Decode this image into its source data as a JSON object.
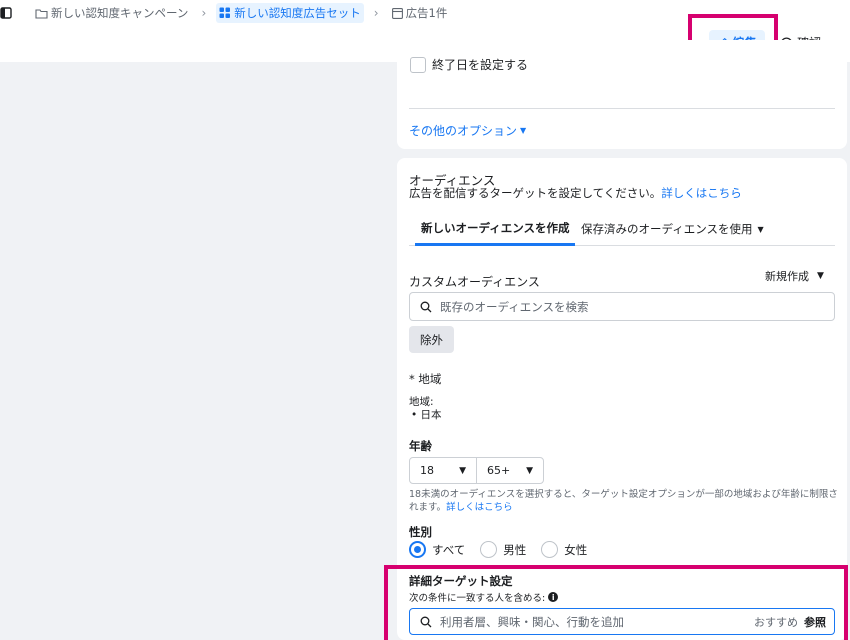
{
  "breadcrumb": {
    "campaign": "新しい認知度キャンペーン",
    "adset": "新しい認知度広告セット",
    "ads": "広告1件"
  },
  "header": {
    "edit_label": "編集",
    "review_label": "確認"
  },
  "schedule": {
    "end_date_label": "終了日を設定する",
    "more_options": "その他のオプション"
  },
  "audience": {
    "title": "オーディエンス",
    "subtitle": "広告を配信するターゲットを設定してください。",
    "learn_more": "詳しくはこちら",
    "tabs": [
      {
        "label": "新しいオーディエンスを作成"
      },
      {
        "label": "保存済みのオーディエンスを使用"
      }
    ],
    "custom_audience_label": "カスタムオーディエンス",
    "new_create": "新規作成",
    "search_placeholder": "既存のオーディエンスを検索",
    "exclude_label": "除外",
    "location_label": "* 地域",
    "location_sub": "地域:",
    "location_value": "• 日本",
    "age_label": "年齢",
    "age_min": "18",
    "age_max": "65+",
    "age_note": "18未満のオーディエンスを選択すると、ターゲット設定オプションが一部の地域および年齢に制限されます。",
    "age_note_link": "詳しくはこちら",
    "gender_label": "性別",
    "gender_options": [
      {
        "label": "すべて",
        "selected": true
      },
      {
        "label": "男性",
        "selected": false
      },
      {
        "label": "女性",
        "selected": false
      }
    ],
    "detailed_title": "詳細ターゲット設定",
    "detailed_sub": "次の条件に一致する人を含める:",
    "detailed_placeholder": "利用者層、興味・関心、行動を追加",
    "suggestions": "おすすめ",
    "browse": "参照"
  },
  "colors": {
    "accent": "#1877f2",
    "highlight": "#d6006f"
  }
}
